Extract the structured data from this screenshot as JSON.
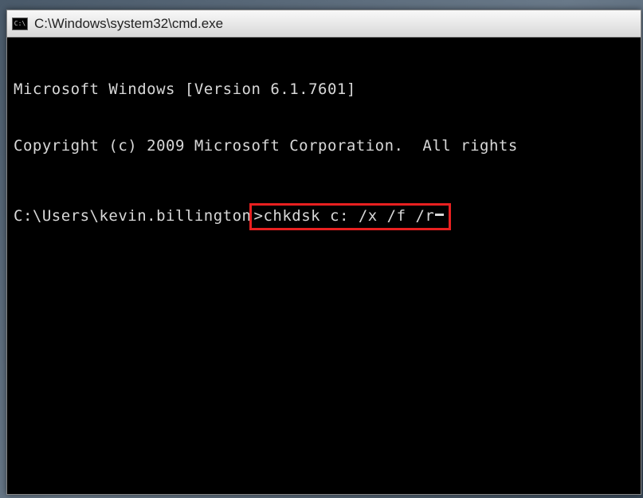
{
  "titlebar": {
    "icon_label": "C:\\",
    "title": "C:\\Windows\\system32\\cmd.exe"
  },
  "terminal": {
    "line1": "Microsoft Windows [Version 6.1.7601]",
    "line2": "Copyright (c) 2009 Microsoft Corporation.  All rights",
    "prompt": "C:\\Users\\kevin.billington",
    "prompt_suffix": ">",
    "command": "chkdsk c: /x /f /r"
  }
}
